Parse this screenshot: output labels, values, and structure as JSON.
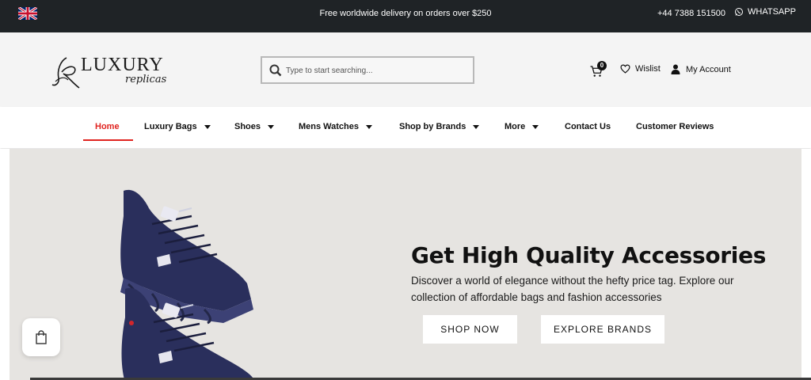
{
  "topbar": {
    "flag_icon": "uk-flag-icon",
    "promo": "Free worldwide delivery on orders over $250",
    "phone": "+44 7388 151500",
    "whatsapp": "WHATSAPP"
  },
  "header": {
    "logo_word": "LUXURY",
    "logo_script": "replicas",
    "search_placeholder": "Type to start searching...",
    "cart_count": "0",
    "wishlist": "Wislist",
    "account": "My Account"
  },
  "nav": {
    "items": [
      {
        "label": "Home",
        "active": true
      },
      {
        "label": "Luxury Bags",
        "dropdown": true
      },
      {
        "label": "Shoes",
        "dropdown": true
      },
      {
        "label": "Mens Watches",
        "dropdown": true
      },
      {
        "label": "Shop by Brands",
        "dropdown": true
      },
      {
        "label": "More",
        "dropdown": true
      },
      {
        "label": "Contact Us"
      },
      {
        "label": "Customer Reviews"
      }
    ]
  },
  "hero": {
    "title": "Get High Quality Accessories",
    "subtitle": "Discover a world of elegance without the hefty price tag. Explore our collection of affordable bags and fashion accessories",
    "shop_now": "SHOP NOW",
    "explore_brands": "EXPLORE BRANDS"
  },
  "colors": {
    "topbar_bg": "#1f2326",
    "accent_red": "#e0231f",
    "hero_bg": "#e6e4e1",
    "shoe_navy": "#2a2f5c"
  }
}
